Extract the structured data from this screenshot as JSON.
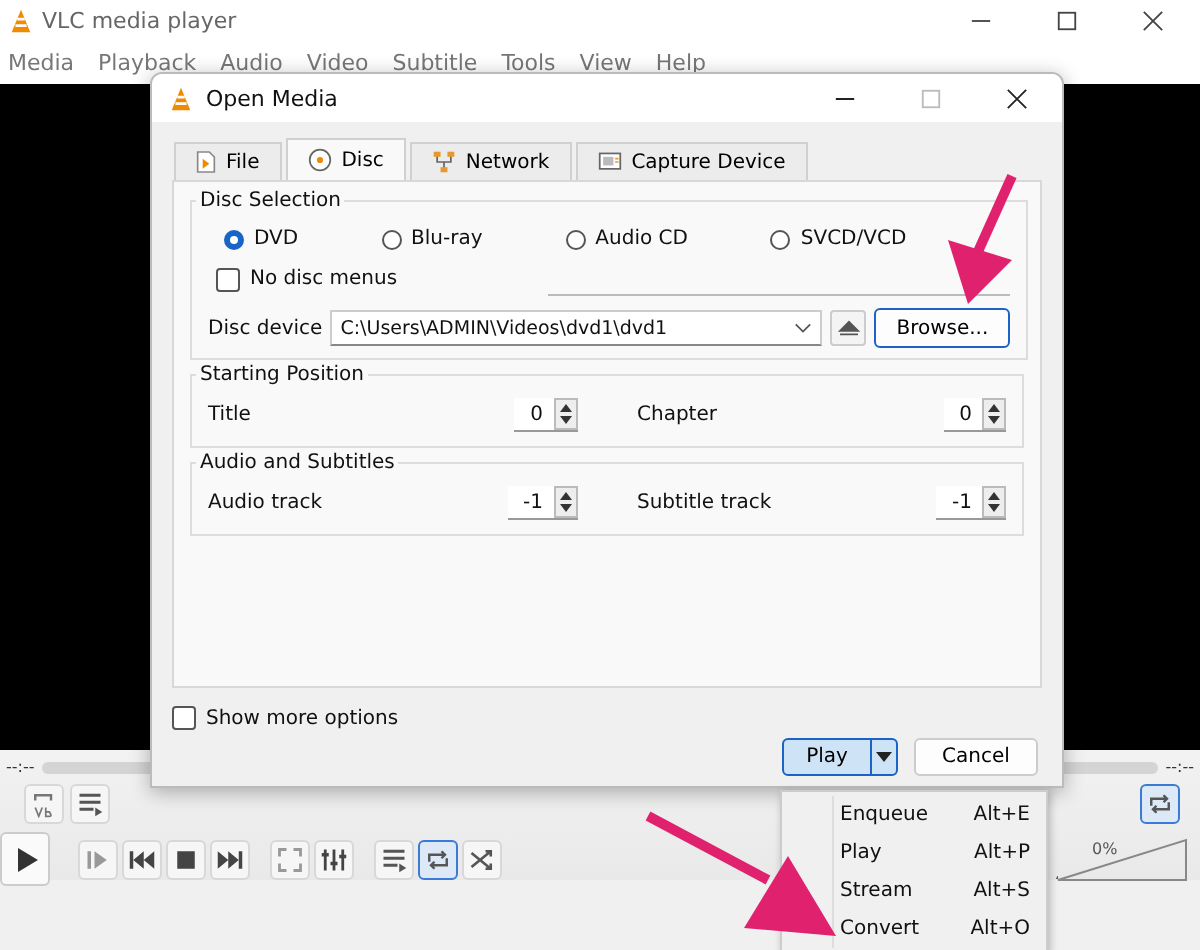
{
  "window": {
    "title": "VLC media player"
  },
  "menu_bar": [
    "Media",
    "Playback",
    "Audio",
    "Video",
    "Subtitle",
    "Tools",
    "View",
    "Help"
  ],
  "dialog": {
    "title": "Open Media",
    "tabs": [
      {
        "label": "File",
        "kind": "file",
        "selected": false
      },
      {
        "label": "Disc",
        "kind": "disc",
        "selected": true
      },
      {
        "label": "Network",
        "kind": "network",
        "selected": false
      },
      {
        "label": "Capture Device",
        "kind": "capture",
        "selected": false
      }
    ],
    "disc_selection": {
      "title": "Disc Selection",
      "disc_types": [
        {
          "label": "DVD",
          "selected": true
        },
        {
          "label": "Blu-ray",
          "selected": false
        },
        {
          "label": "Audio CD",
          "selected": false
        },
        {
          "label": "SVCD/VCD",
          "selected": false
        }
      ],
      "no_disc_menus": {
        "label": "No disc menus",
        "checked": false
      },
      "device_label": "Disc device",
      "device_value": "C:\\Users\\ADMIN\\Videos\\dvd1\\dvd1",
      "browse_button": "Browse..."
    },
    "groups": [
      {
        "title": "Starting Position",
        "fields": [
          {
            "label": "Title",
            "value": "0"
          },
          {
            "label": "Chapter",
            "value": "0"
          }
        ]
      },
      {
        "title": "Audio and Subtitles",
        "fields": [
          {
            "label": "Audio track",
            "value": "-1"
          },
          {
            "label": "Subtitle track",
            "value": "-1"
          }
        ]
      }
    ],
    "show_more_options": {
      "label": "Show more options",
      "checked": false
    },
    "play_button": "Play",
    "cancel_button": "Cancel"
  },
  "play_menu": [
    {
      "label": "Enqueue",
      "shortcut": "Alt+E"
    },
    {
      "label": "Play",
      "shortcut": "Alt+P"
    },
    {
      "label": "Stream",
      "shortcut": "Alt+S"
    },
    {
      "label": "Convert",
      "shortcut": "Alt+O"
    }
  ],
  "player": {
    "elapsed": "--:--",
    "total": "--:--",
    "volume": {
      "text": "0%",
      "level": 0
    },
    "loop_on": true
  }
}
